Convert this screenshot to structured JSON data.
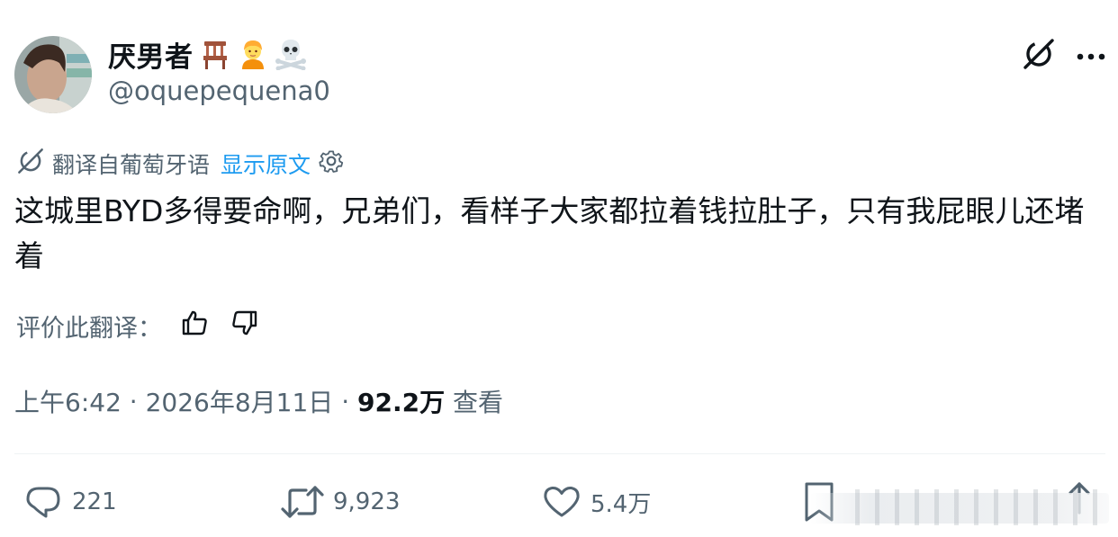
{
  "author": {
    "display_name": "厌男者",
    "name_emojis": [
      "chair-emoji",
      "person-blond-emoji",
      "skull-crossbones-emoji"
    ],
    "handle": "@oquepequena0"
  },
  "translation": {
    "label": "翻译自葡萄牙语",
    "show_original": "显示原文"
  },
  "tweet": {
    "text": "这城里BYD多得要命啊，兄弟们，看样子大家都拉着钱拉肚子，只有我屁眼儿还堵着"
  },
  "rating": {
    "label": "评价此翻译："
  },
  "meta": {
    "time": "上午6:42",
    "separator": " · ",
    "date": "2026年8月11日",
    "views_count": "92.2万",
    "views_label": " 查看"
  },
  "actions": {
    "replies": "221",
    "reposts": "9,923",
    "likes": "5.4万"
  },
  "colors": {
    "text_primary": "#0f1419",
    "text_secondary": "#536471",
    "accent": "#1d9bf0",
    "divider": "#eff3f4"
  }
}
